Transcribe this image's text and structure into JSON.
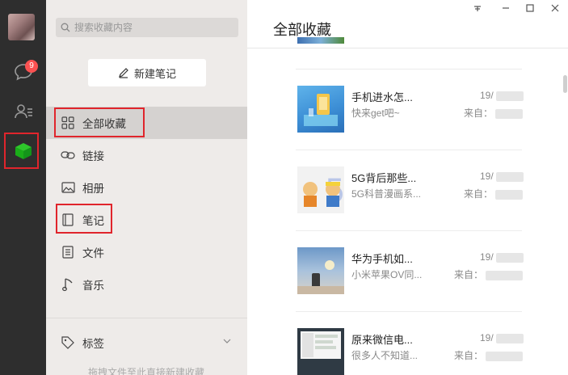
{
  "rail": {
    "chat_badge": "9"
  },
  "search": {
    "placeholder": "搜索收藏内容"
  },
  "panel": {
    "new_note_label": "新建笔记",
    "nav": [
      {
        "label": "全部收藏",
        "icon": "grid-icon"
      },
      {
        "label": "链接",
        "icon": "link-icon"
      },
      {
        "label": "相册",
        "icon": "image-icon"
      },
      {
        "label": "笔记",
        "icon": "notebook-icon"
      },
      {
        "label": "文件",
        "icon": "file-icon"
      },
      {
        "label": "音乐",
        "icon": "music-icon"
      }
    ],
    "tags_label": "标签",
    "hint": "拖拽文件至此直接新建收藏"
  },
  "main": {
    "title": "全部收藏",
    "items": [
      {
        "title": "手机进水怎...",
        "desc": "快来get吧~",
        "date": "19/",
        "source_prefix": "来自："
      },
      {
        "title": "5G背后那些...",
        "desc": "5G科普漫画系...",
        "date": "19/",
        "source_prefix": "来自："
      },
      {
        "title": "华为手机如...",
        "desc": "小米苹果OV同...",
        "date": "19/",
        "source_prefix": "来自："
      },
      {
        "title": "原来微信电...",
        "desc": "很多人不知道...",
        "date": "19/",
        "source_prefix": "来自："
      }
    ]
  },
  "colors": {
    "accent_green": "#1aad19",
    "highlight_red": "#e0252c",
    "badge_red": "#fa5151"
  }
}
